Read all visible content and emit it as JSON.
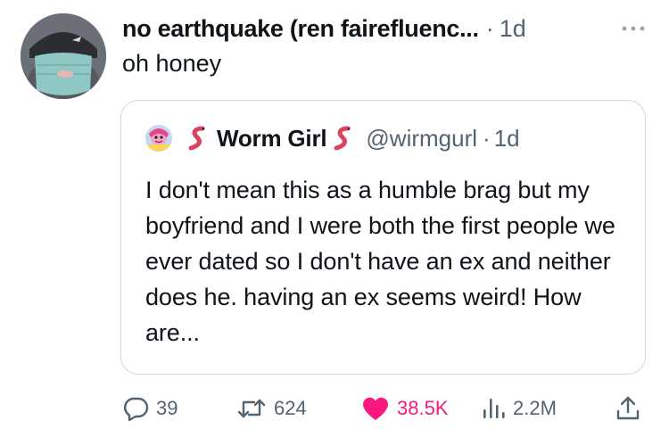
{
  "tweet": {
    "author_name": "no earthquake (ren fairefluenc...",
    "separator": "·",
    "timestamp": "1d",
    "text": "oh honey"
  },
  "quote": {
    "author_name": "Worm Girl",
    "handle": "@wirmgurl",
    "separator": "·",
    "timestamp": "1d",
    "text": "I don't mean this as a humble brag but my boyfriend and I were both the first people we ever dated so I don't have an ex and neither does he. having an ex seems weird! How are..."
  },
  "actions": {
    "replies": "39",
    "reposts": "624",
    "likes": "38.5K",
    "views": "2.2M"
  },
  "icons": {
    "more": "more-horizontal-icon",
    "reply": "reply-bubble-icon",
    "repost": "repost-arrows-icon",
    "like": "heart-filled-icon",
    "views": "views-bar-chart-icon",
    "share": "share-upload-icon",
    "worm": "worm-emoji-icon"
  },
  "colors": {
    "text": "#0f1419",
    "secondary": "#536471",
    "like": "#f91880",
    "border": "#cfd9de",
    "worm": "#d9455f"
  }
}
